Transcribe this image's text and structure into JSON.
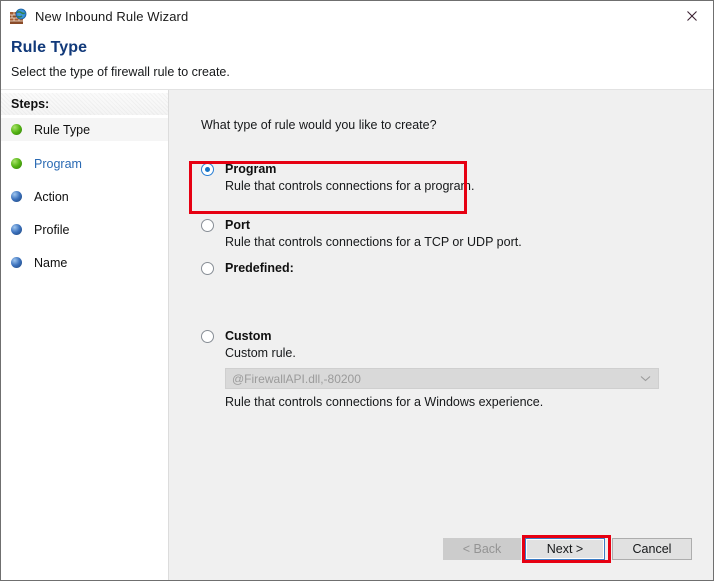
{
  "window": {
    "title": "New Inbound Rule Wizard",
    "icon": "firewall-globe-icon",
    "close_label": "✕"
  },
  "header": {
    "title": "Rule Type",
    "subtitle": "Select the type of firewall rule to create.",
    "title_color": "#11397a"
  },
  "sidebar": {
    "header_label": "Steps:",
    "items": [
      {
        "label": "Rule Type",
        "bullet": "green",
        "state": "current"
      },
      {
        "label": "Program",
        "bullet": "green",
        "state": "link"
      },
      {
        "label": "Action",
        "bullet": "blue",
        "state": "pending"
      },
      {
        "label": "Profile",
        "bullet": "blue",
        "state": "pending"
      },
      {
        "label": "Name",
        "bullet": "blue",
        "state": "pending"
      }
    ]
  },
  "main": {
    "prompt": "What type of rule would you like to create?",
    "options": [
      {
        "title": "Program",
        "description": "Rule that controls connections for a program.",
        "selected": true
      },
      {
        "title": "Port",
        "description": "Rule that controls connections for a TCP or UDP port.",
        "selected": false
      },
      {
        "title": "Predefined:",
        "description": "Rule that controls connections for a Windows experience.",
        "selected": false
      },
      {
        "title": "Custom",
        "description": "Custom rule.",
        "selected": false
      }
    ],
    "predefined_combo": {
      "value": "@FirewallAPI.dll,-80200",
      "disabled": true
    }
  },
  "footer": {
    "back_label": "< Back",
    "next_label": "Next >",
    "cancel_label": "Cancel"
  },
  "annotations": {
    "color": "#e60012",
    "targets": [
      "program-option",
      "next-button"
    ]
  }
}
